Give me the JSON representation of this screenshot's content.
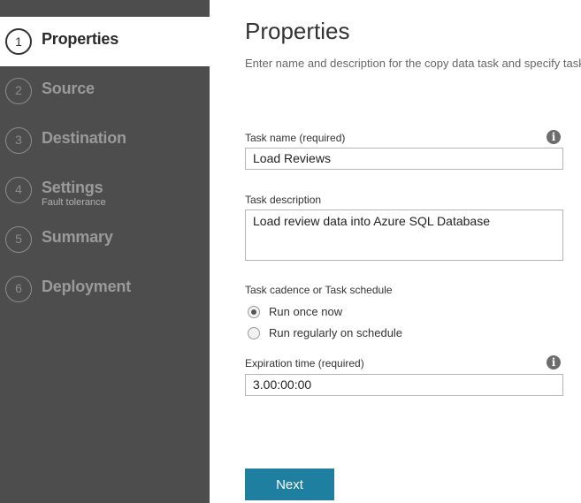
{
  "steps": [
    {
      "num": "1",
      "label": "Properties",
      "sub": ""
    },
    {
      "num": "2",
      "label": "Source",
      "sub": ""
    },
    {
      "num": "3",
      "label": "Destination",
      "sub": ""
    },
    {
      "num": "4",
      "label": "Settings",
      "sub": "Fault tolerance"
    },
    {
      "num": "5",
      "label": "Summary",
      "sub": ""
    },
    {
      "num": "6",
      "label": "Deployment",
      "sub": ""
    }
  ],
  "page": {
    "title": "Properties",
    "description": "Enter name and description for the copy data task and specify task."
  },
  "form": {
    "task_name": {
      "label": "Task name (required)",
      "value": "Load Reviews"
    },
    "task_description": {
      "label": "Task description",
      "value": "Load review data into Azure SQL Database"
    },
    "cadence": {
      "label": "Task cadence or Task schedule",
      "options": [
        {
          "label": "Run once now",
          "selected": true
        },
        {
          "label": "Run regularly on schedule",
          "selected": false
        }
      ]
    },
    "expiration": {
      "label": "Expiration time (required)",
      "value": "3.00:00:00"
    }
  },
  "info_glyph": "i",
  "buttons": {
    "next": "Next"
  }
}
